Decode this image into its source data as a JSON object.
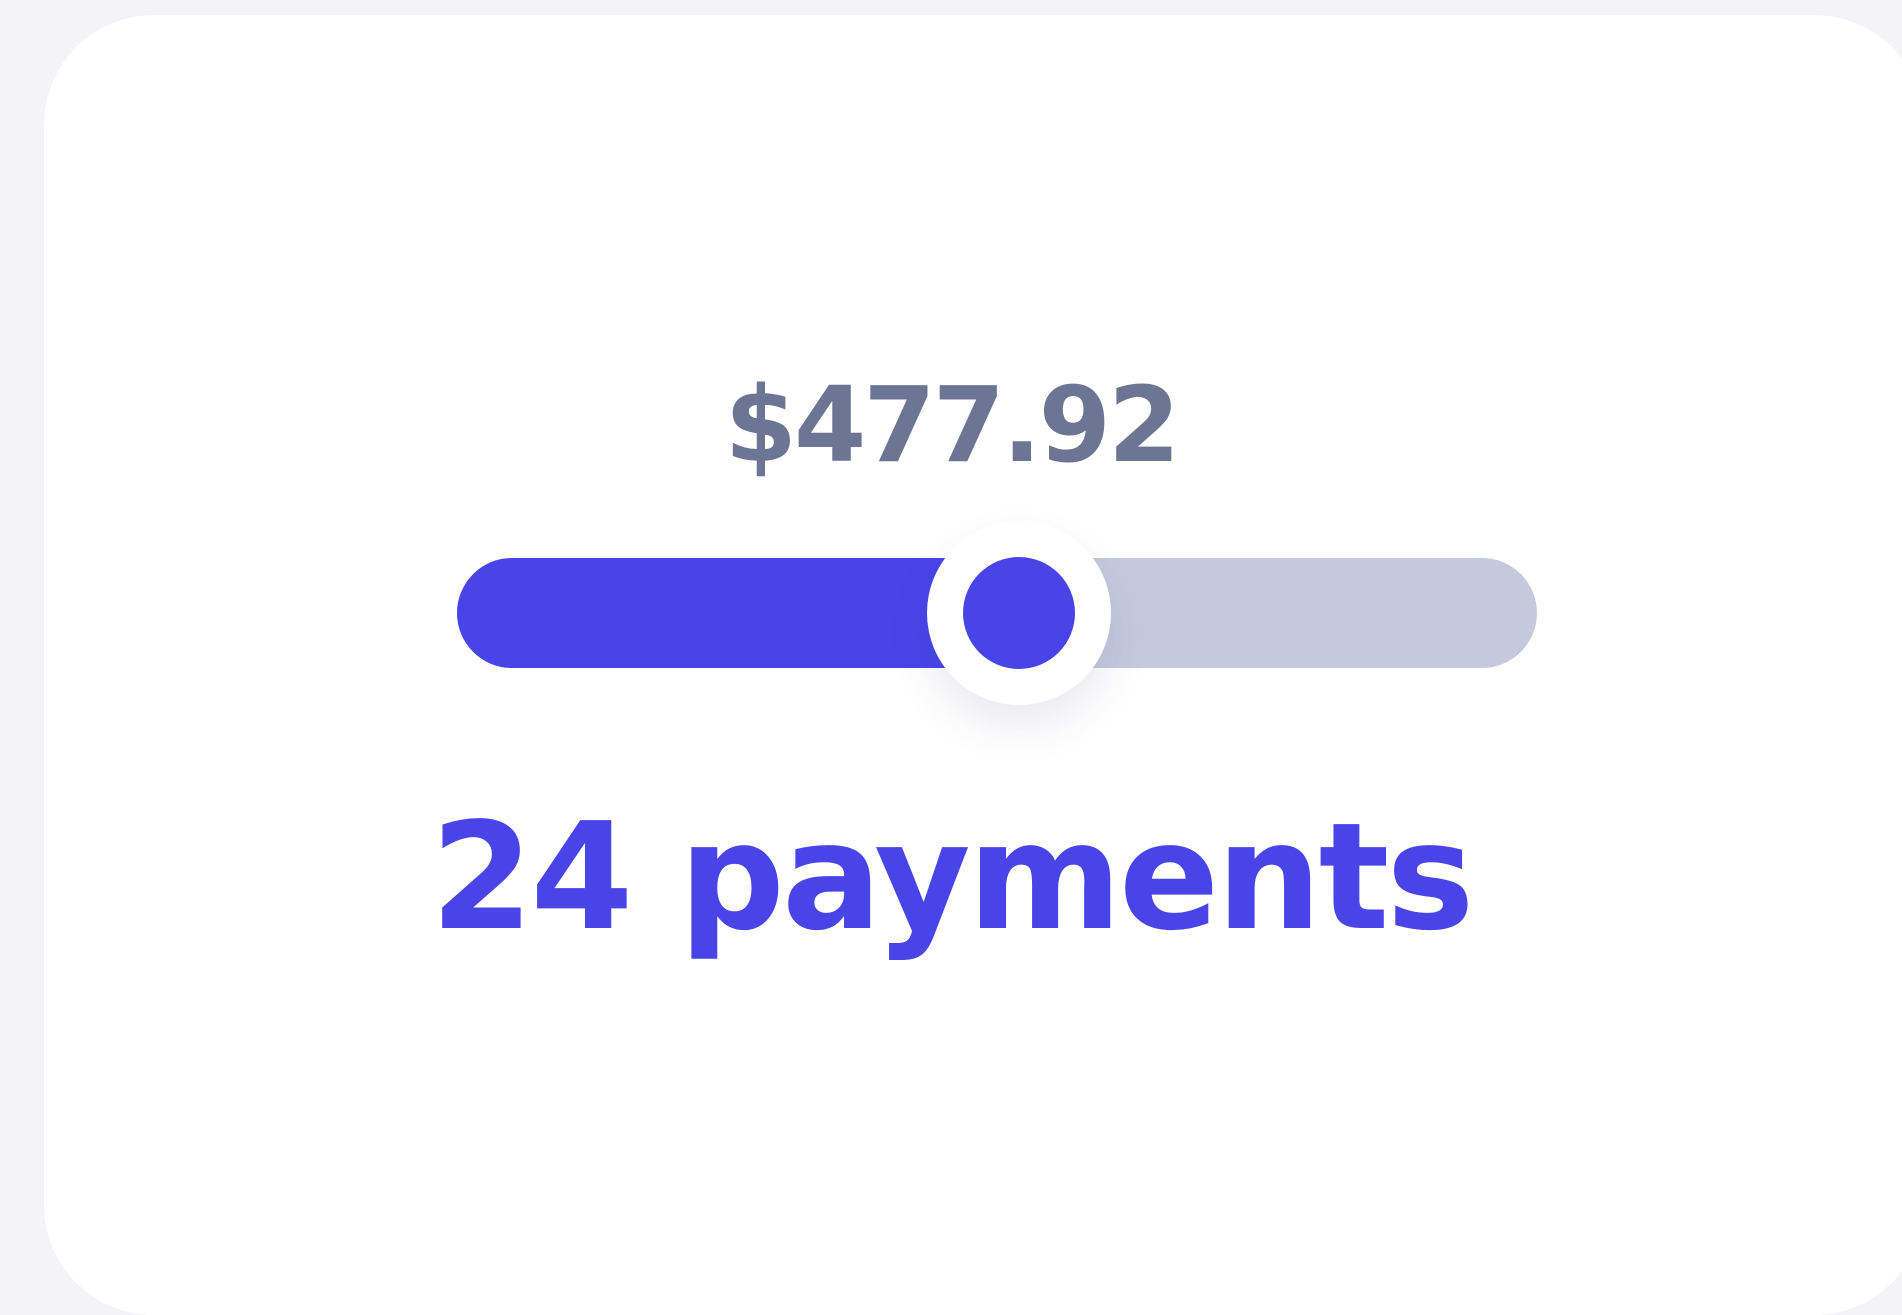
{
  "payment_amount": "$477.92",
  "payments_label": "24 payments",
  "slider": {
    "value_fraction": 0.52
  },
  "colors": {
    "accent": "#4844e8",
    "amount_text": "#6d7595",
    "track_inactive": "#c5c9de",
    "card_background": "#ffffff",
    "page_background": "#f4f4f8"
  }
}
